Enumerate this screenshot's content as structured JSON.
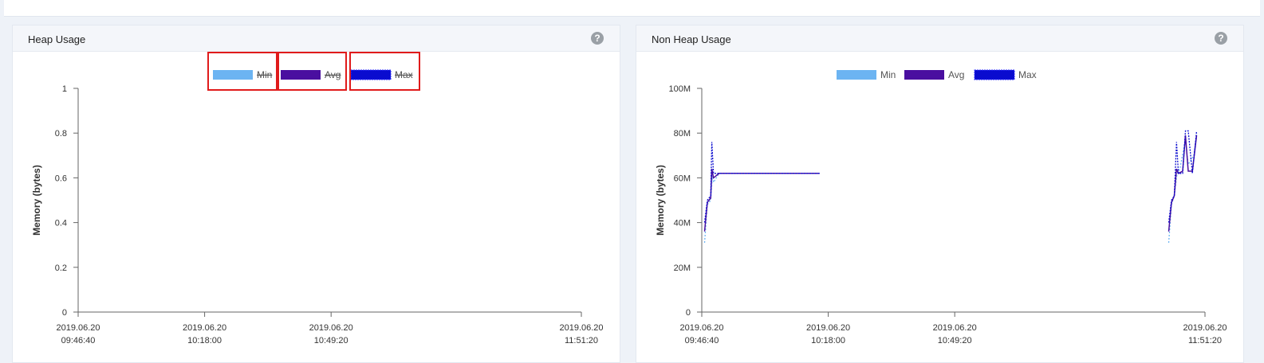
{
  "colors": {
    "min": "#6cb4f2",
    "avg": "#4a0fa0",
    "max": "#0a0ccf",
    "highlight": "#e01b1b"
  },
  "left_panel": {
    "title": "Heap Usage",
    "help_icon": "question-icon",
    "help_glyph": "?"
  },
  "right_panel": {
    "title": "Non Heap Usage",
    "help_icon": "question-icon",
    "help_glyph": "?"
  },
  "chart_data": [
    {
      "type": "line",
      "title": "Heap Usage",
      "ylabel": "Memory (bytes)",
      "xlabel": "",
      "ylim": [
        0,
        1
      ],
      "y_ticks": [
        "0",
        "0.2",
        "0.4",
        "0.6",
        "0.8",
        "1"
      ],
      "x_ticks": [
        {
          "date": "2019.06.20",
          "time": "09:46:40"
        },
        {
          "date": "2019.06.20",
          "time": "10:18:00"
        },
        {
          "date": "2019.06.20",
          "time": "10:49:20"
        },
        {
          "date": "2019.06.20",
          "time": "11:51:20"
        }
      ],
      "legend": {
        "placement": "top-center"
      },
      "series": [
        {
          "name": "Min",
          "hidden": true,
          "values": []
        },
        {
          "name": "Avg",
          "hidden": true,
          "values": []
        },
        {
          "name": "Max",
          "hidden": true,
          "values": []
        }
      ]
    },
    {
      "type": "line",
      "title": "Non Heap Usage",
      "ylabel": "Memory (bytes)",
      "xlabel": "",
      "ylim": [
        0,
        100
      ],
      "y_ticks": [
        "0",
        "20M",
        "40M",
        "60M",
        "80M",
        "100M"
      ],
      "x_ticks": [
        {
          "date": "2019.06.20",
          "time": "09:46:40"
        },
        {
          "date": "2019.06.20",
          "time": "10:18:00"
        },
        {
          "date": "2019.06.20",
          "time": "10:49:20"
        },
        {
          "date": "2019.06.20",
          "time": "11:51:20"
        }
      ],
      "legend": {
        "placement": "top-center"
      },
      "series": [
        {
          "name": "Min",
          "hidden": false,
          "values": [
            [
              9.88,
              31
            ],
            [
              9.98,
              48
            ],
            [
              10.1,
              50
            ],
            [
              10.16,
              61
            ],
            [
              10.2,
              58
            ],
            [
              10.4,
              62
            ],
            [
              12.0,
              62
            ],
            [
              13.0,
              62
            ],
            [
              14.0,
              62
            ],
            [
              null,
              null
            ],
            [
              26.5,
              31
            ],
            [
              26.6,
              48
            ],
            [
              26.7,
              52
            ],
            [
              26.8,
              62
            ],
            [
              26.9,
              64
            ],
            [
              27.1,
              77
            ],
            [
              27.2,
              66
            ],
            [
              27.4,
              70
            ],
            [
              27.5,
              80
            ]
          ]
        },
        {
          "name": "Avg",
          "hidden": false,
          "values": [
            [
              9.88,
              36
            ],
            [
              9.98,
              49
            ],
            [
              10.1,
              51
            ],
            [
              10.14,
              64
            ],
            [
              10.2,
              60
            ],
            [
              10.4,
              62
            ],
            [
              12.0,
              62
            ],
            [
              13.0,
              62
            ],
            [
              14.0,
              62
            ],
            [
              null,
              null
            ],
            [
              26.5,
              36
            ],
            [
              26.6,
              49
            ],
            [
              26.7,
              52
            ],
            [
              26.78,
              64
            ],
            [
              26.85,
              62
            ],
            [
              27.0,
              63
            ],
            [
              27.1,
              79
            ],
            [
              27.2,
              63
            ],
            [
              27.35,
              63
            ],
            [
              27.5,
              79
            ]
          ]
        },
        {
          "name": "Max",
          "hidden": false,
          "values": [
            [
              9.88,
              40
            ],
            [
              9.98,
              50
            ],
            [
              10.1,
              52
            ],
            [
              10.14,
              76
            ],
            [
              10.2,
              62
            ],
            [
              10.4,
              62
            ],
            [
              12.0,
              62
            ],
            [
              13.0,
              62
            ],
            [
              14.0,
              62
            ],
            [
              null,
              null
            ],
            [
              26.5,
              40
            ],
            [
              26.6,
              50
            ],
            [
              26.7,
              52
            ],
            [
              26.78,
              76
            ],
            [
              26.85,
              62
            ],
            [
              27.0,
              62
            ],
            [
              27.1,
              81
            ],
            [
              27.2,
              81
            ],
            [
              27.35,
              62
            ],
            [
              27.5,
              81
            ]
          ]
        }
      ]
    }
  ]
}
